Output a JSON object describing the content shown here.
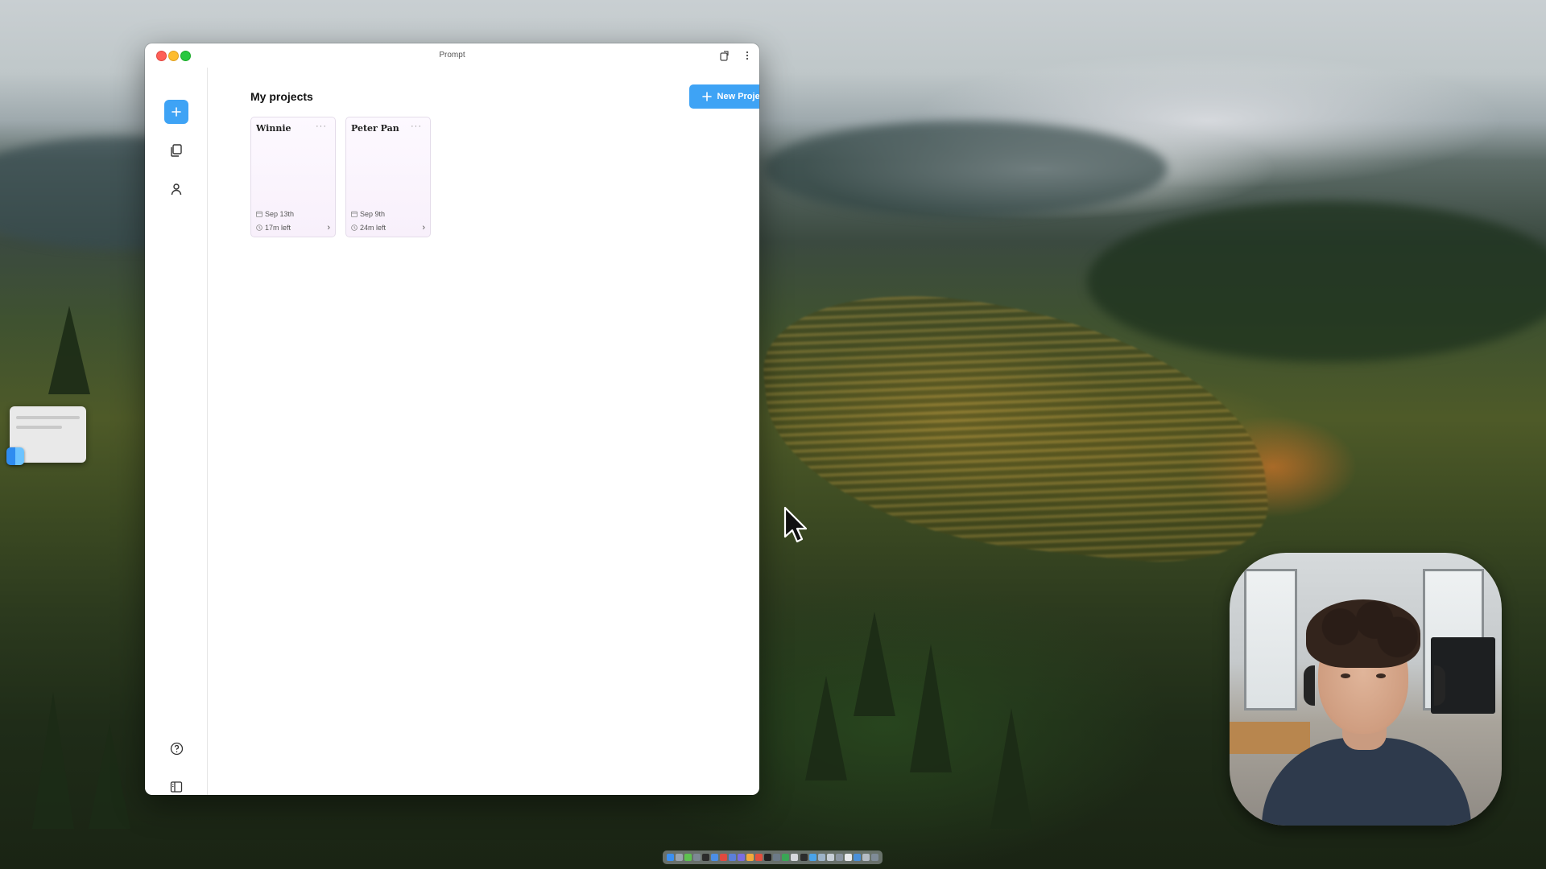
{
  "window": {
    "title": "Prompt"
  },
  "main": {
    "page_title": "My projects",
    "new_project_label": "New Project",
    "projects": [
      {
        "name": "Winnie",
        "menu": "···",
        "date": "Sep 13th",
        "time_left": "17m left",
        "arrow": "›"
      },
      {
        "name": "Peter Pan",
        "menu": "···",
        "date": "Sep 9th",
        "time_left": "24m left",
        "arrow": "›"
      }
    ]
  },
  "sidebar": {
    "items": [
      {
        "icon": "plus-icon",
        "label": ""
      },
      {
        "icon": "projects-icon",
        "label": ""
      },
      {
        "icon": "user-icon",
        "label": ""
      },
      {
        "icon": "help-icon",
        "label": ""
      },
      {
        "icon": "sidebar-toggle-icon",
        "label": ""
      }
    ]
  },
  "colors": {
    "accent": "#3ea3f5",
    "card_bg": "#f8f0fb",
    "card_border": "#e4dcea",
    "close": "#fe5f57",
    "minimize": "#febc2e",
    "maximize": "#28c840"
  },
  "dock": {
    "icons": [
      "#3b8ff0",
      "#9aa3ad",
      "#5ec14f",
      "#7d8894",
      "#2b2b2b",
      "#4c8ee6",
      "#e04a3f",
      "#5b7fd9",
      "#7a6de0",
      "#f2a93b",
      "#e3503e",
      "#222222",
      "#6c7a88",
      "#3aa655",
      "#d5d8dc",
      "#2c2c2c",
      "#4aa3e8",
      "#9db3c8",
      "#c6ced6",
      "#8a95a1",
      "#e8eaec",
      "#4a90d9",
      "#b5bcc4",
      "#7f8b97"
    ]
  }
}
